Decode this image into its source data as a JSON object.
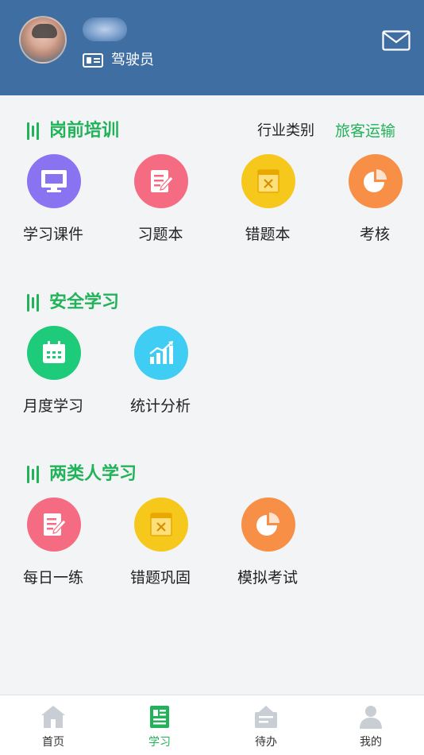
{
  "header": {
    "role": "驾驶员",
    "avatar_icon": "user-avatar",
    "mail_icon": "mail-icon",
    "colors": {
      "background": "#3f6ea3"
    }
  },
  "sections": [
    {
      "title": "岗前培训",
      "industry_label": "行业类别",
      "industry_value": "旅客运输",
      "items": [
        {
          "label": "学习课件",
          "icon": "monitor-icon",
          "color": "#8a73f0"
        },
        {
          "label": "习题本",
          "icon": "edit-notebook-icon",
          "color": "#f56b82"
        },
        {
          "label": "错题本",
          "icon": "wrong-book-icon",
          "color": "#f7c81c"
        },
        {
          "label": "考核",
          "icon": "pie-chart-icon",
          "color": "#f79046"
        }
      ]
    },
    {
      "title": "安全学习",
      "items": [
        {
          "label": "月度学习",
          "icon": "calendar-icon",
          "color": "#1ecb7a"
        },
        {
          "label": "统计分析",
          "icon": "bar-chart-icon",
          "color": "#3fcdf4"
        }
      ]
    },
    {
      "title": "两类人学习",
      "items": [
        {
          "label": "每日一练",
          "icon": "edit-notebook-icon",
          "color": "#f56b82"
        },
        {
          "label": "错题巩固",
          "icon": "wrong-book-icon",
          "color": "#f7c81c"
        },
        {
          "label": "模拟考试",
          "icon": "pie-chart-icon",
          "color": "#f79046"
        }
      ]
    }
  ],
  "bottom_nav": [
    {
      "label": "首页",
      "icon": "home-icon",
      "active": false
    },
    {
      "label": "学习",
      "icon": "study-icon",
      "active": true
    },
    {
      "label": "待办",
      "icon": "todo-icon",
      "active": false
    },
    {
      "label": "我的",
      "icon": "profile-icon",
      "active": false
    }
  ],
  "colors": {
    "accent": "#22b35a",
    "inactive_icon": "#c9cdd4"
  }
}
